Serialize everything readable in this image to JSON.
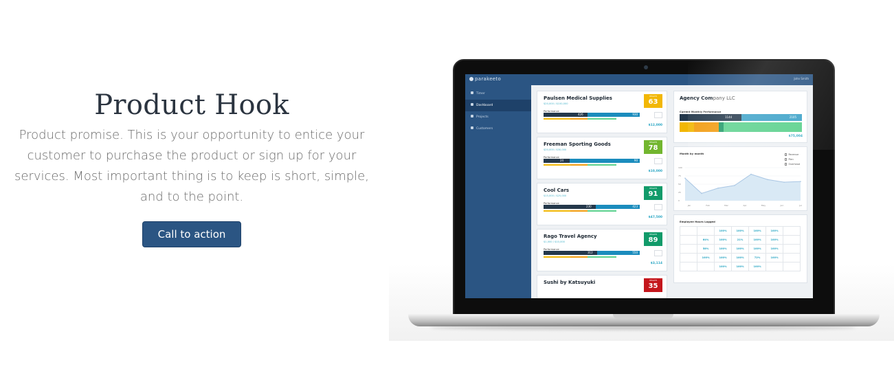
{
  "hero": {
    "title": "Product Hook",
    "text": "Product promise. This is your opportunity to entice your customer to purchase the product or sign up for your services. Most important thing is to keep is short, simple, and to the point.",
    "cta_label": "Call to action"
  },
  "app": {
    "logo": "parakeeto",
    "user": "John Smith",
    "sidebar": [
      {
        "label": "Timer",
        "icon": "clock-icon"
      },
      {
        "label": "Dashboard",
        "icon": "dashboard-icon"
      },
      {
        "label": "Projects",
        "icon": "star-icon"
      },
      {
        "label": "Customers",
        "icon": "users-icon"
      }
    ],
    "clients": [
      {
        "name": "Paulsen Medical Supplies",
        "sub": "$20,000 / $100,000",
        "perf_label": "Performance",
        "v1": "426",
        "v2": "930",
        "dark_pct": 0.46,
        "amount": "$12,000",
        "health_label": "HEALTH",
        "health": "63",
        "health_color": "#f2b705",
        "side_box": "1000"
      },
      {
        "name": "Freeman Sporting Goods",
        "sub": "$20,000 / $30,000",
        "perf_label": "Performance",
        "v1": "24",
        "v2": "90",
        "dark_pct": 0.27,
        "amount": "$10,000",
        "health_label": "HEALTH",
        "health": "78",
        "health_color": "#72b62f",
        "side_box": ""
      },
      {
        "name": "Cool Cars",
        "sub": "$15,000 / $25,000",
        "perf_label": "Performance",
        "v1": "230",
        "v2": "423",
        "dark_pct": 0.54,
        "amount": "$47,500",
        "health_label": "HEALTH",
        "health": "91",
        "health_color": "#129b6a",
        "side_box": ""
      },
      {
        "name": "Rago Travel Agency",
        "sub": "$1,000 / $10,000",
        "perf_label": "Performance",
        "v1": "312",
        "v2": "550",
        "dark_pct": 0.56,
        "amount": "$3,114",
        "health_label": "HEALTH",
        "health": "89",
        "health_color": "#129b6a",
        "side_box": ""
      },
      {
        "name": "Sushi by Katsuyuki",
        "sub": "",
        "perf_label": "",
        "v1": "",
        "v2": "",
        "dark_pct": 0,
        "amount": "",
        "health_label": "HEALTH",
        "health": "35",
        "health_color": "#c4161c",
        "side_box": ""
      }
    ],
    "agency": {
      "title_bold": "Agency Com",
      "title_light": "pany LLC",
      "sub": "Current Monthly Performance",
      "v1": "1144",
      "v2": "2105",
      "amount": "$75,004",
      "segments": [
        {
          "color": "#f2b705",
          "pct": 0.12
        },
        {
          "color": "#f29b0e",
          "pct": 0.2
        },
        {
          "color": "#1e9968",
          "pct": 0.04
        },
        {
          "color": "#5bd18d",
          "pct": 0.64
        }
      ]
    },
    "month_chart": {
      "title": "Month by month",
      "legend": [
        "Revenue",
        "Plan",
        "Overhead"
      ],
      "x_labels": [
        "Jan",
        "Feb",
        "Mar",
        "Apr",
        "May",
        "Jun",
        "Jul"
      ],
      "y_labels": [
        "100",
        "75",
        "50",
        "25",
        "0"
      ],
      "values": [
        68,
        22,
        38,
        46,
        80,
        64,
        56,
        58
      ],
      "ylim": [
        0,
        100
      ]
    },
    "hours": {
      "title": "Employee Hours Logged",
      "rows": [
        [
          "",
          "",
          "100%",
          "100%",
          "100%",
          "100%",
          ""
        ],
        [
          "",
          "64%",
          "100%",
          "21%",
          "100%",
          "100%",
          ""
        ],
        [
          "",
          "58%",
          "100%",
          "100%",
          "100%",
          "100%",
          ""
        ],
        [
          "",
          "100%",
          "100%",
          "100%",
          "72%",
          "100%",
          ""
        ],
        [
          "",
          "",
          "100%",
          "100%",
          "100%",
          "",
          ""
        ]
      ]
    }
  }
}
